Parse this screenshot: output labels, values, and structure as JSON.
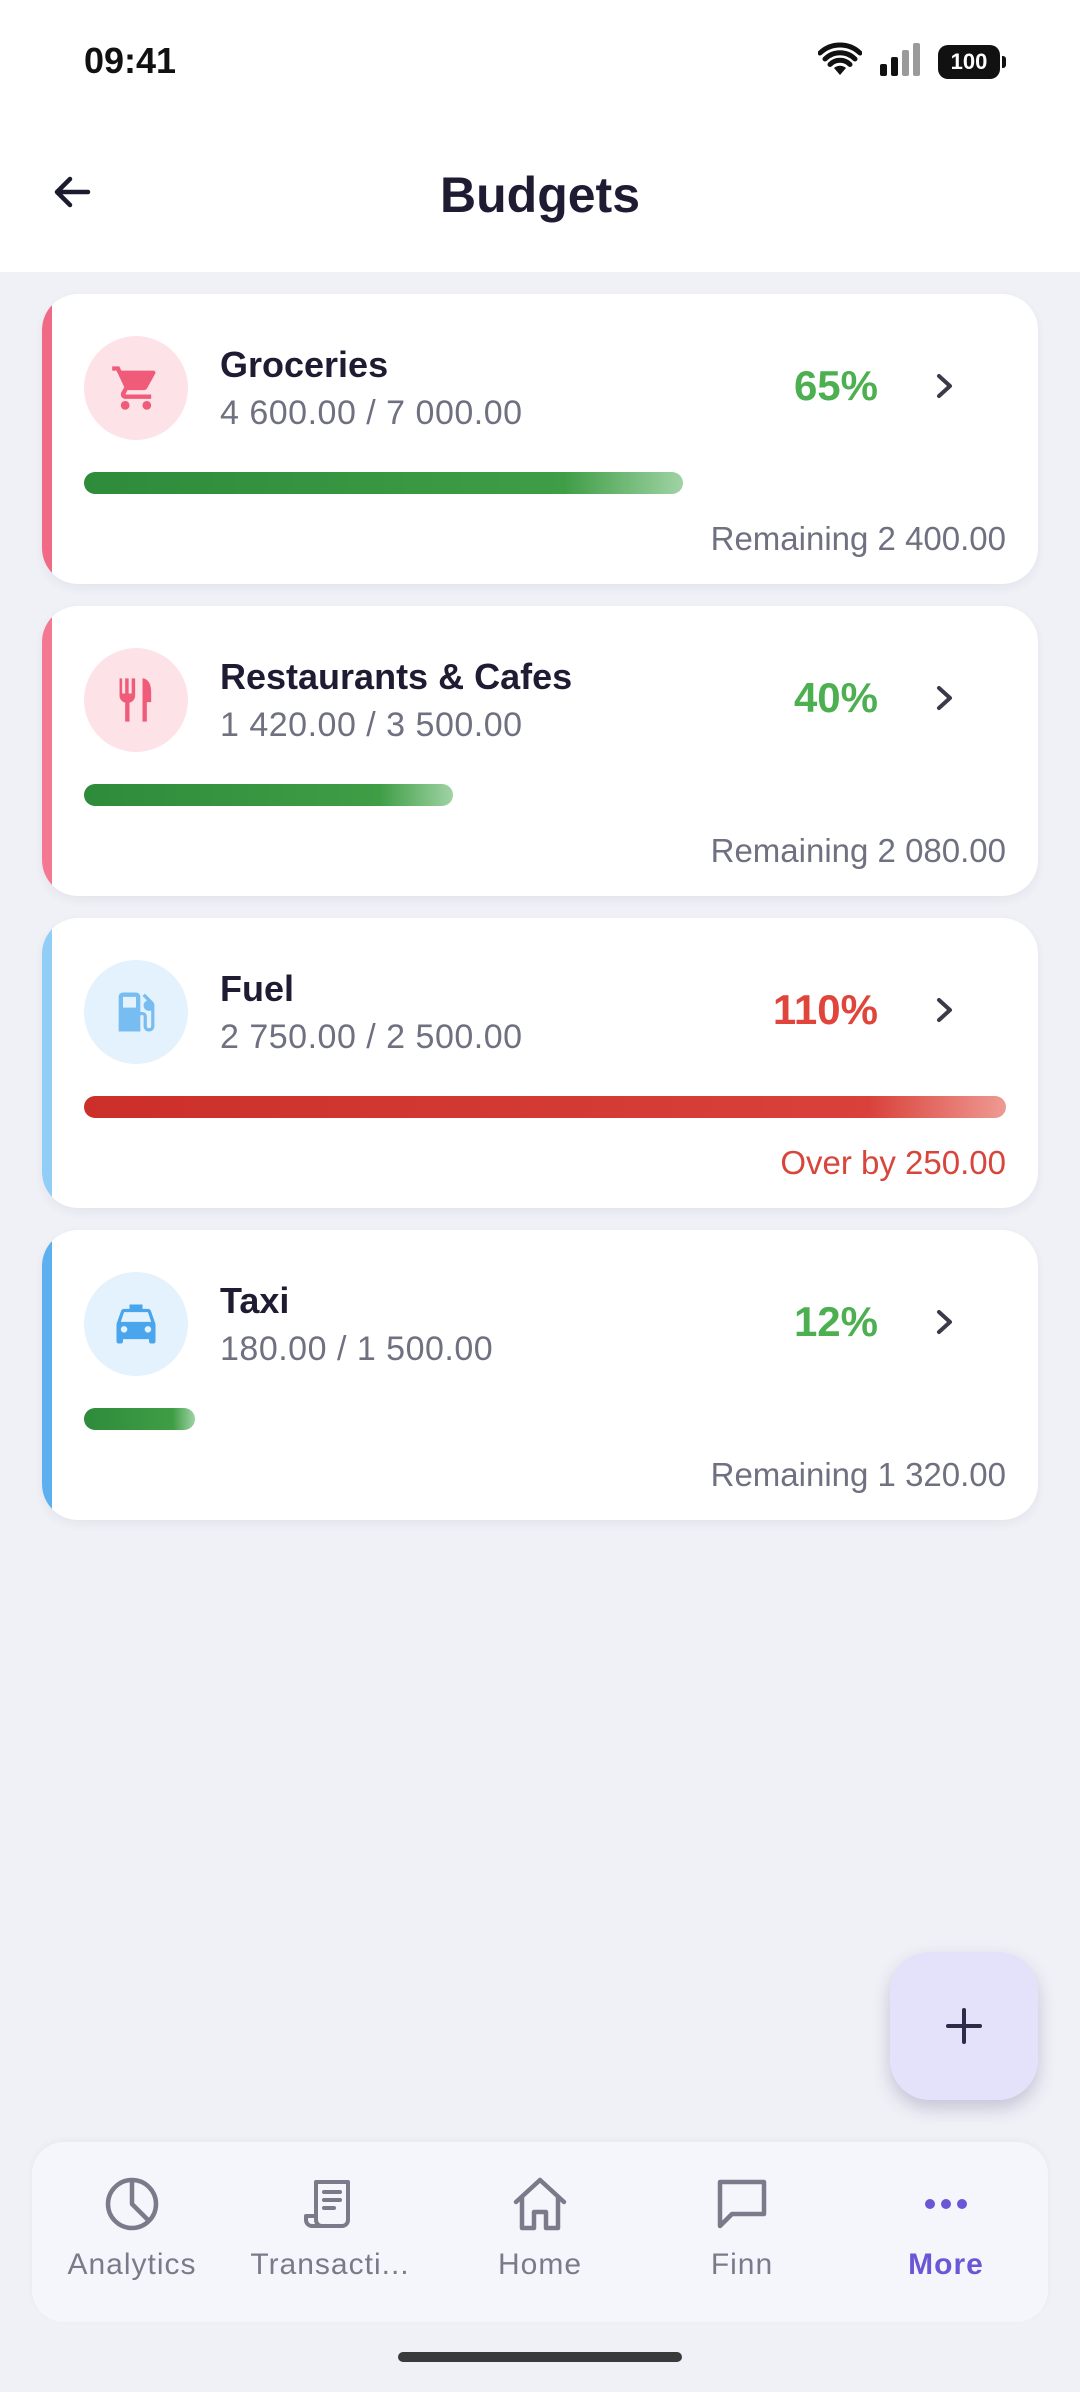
{
  "status": {
    "time": "09:41",
    "battery": "100"
  },
  "header": {
    "title": "Budgets"
  },
  "budgets": [
    {
      "name": "Groceries",
      "amount": "4 600.00 / 7 000.00",
      "percent_label": "65%",
      "progress": 0.65,
      "note": "Remaining 2 400.00",
      "status": "under",
      "icon": "cart-icon",
      "accent": "#f06a86",
      "icon_bg": "#fde3e8",
      "icon_color": "#ef5b78"
    },
    {
      "name": "Restaurants & Cafes",
      "amount": "1 420.00 / 3 500.00",
      "percent_label": "40%",
      "progress": 0.4,
      "note": "Remaining 2 080.00",
      "status": "under",
      "icon": "fork-knife-icon",
      "accent": "#f47892",
      "icon_bg": "#fde3e8",
      "icon_color": "#ef5b78"
    },
    {
      "name": "Fuel",
      "amount": "2 750.00 / 2 500.00",
      "percent_label": "110%",
      "progress": 1.1,
      "note": "Over by 250.00",
      "status": "over",
      "icon": "fuel-pump-icon",
      "accent": "#90cdf7",
      "icon_bg": "#e3f2fd",
      "icon_color": "#77bdf1"
    },
    {
      "name": "Taxi",
      "amount": "180.00 / 1 500.00",
      "percent_label": "12%",
      "progress": 0.12,
      "note": "Remaining 1 320.00",
      "status": "under",
      "icon": "taxi-icon",
      "accent": "#5db0ef",
      "icon_bg": "#e3f2fd",
      "icon_color": "#4aa6ec"
    }
  ],
  "colors": {
    "under": "#4caf50",
    "over": "#e0443a",
    "nav_active": "#6b56d6"
  },
  "fab": {
    "icon": "plus-icon"
  },
  "nav": [
    {
      "label": "Analytics",
      "icon": "pie-chart-icon",
      "active": false
    },
    {
      "label": "Transacti...",
      "icon": "receipt-icon",
      "active": false
    },
    {
      "label": "Home",
      "icon": "home-icon",
      "active": false
    },
    {
      "label": "Finn",
      "icon": "chat-icon",
      "active": false
    },
    {
      "label": "More",
      "icon": "more-dots-icon",
      "active": true
    }
  ]
}
